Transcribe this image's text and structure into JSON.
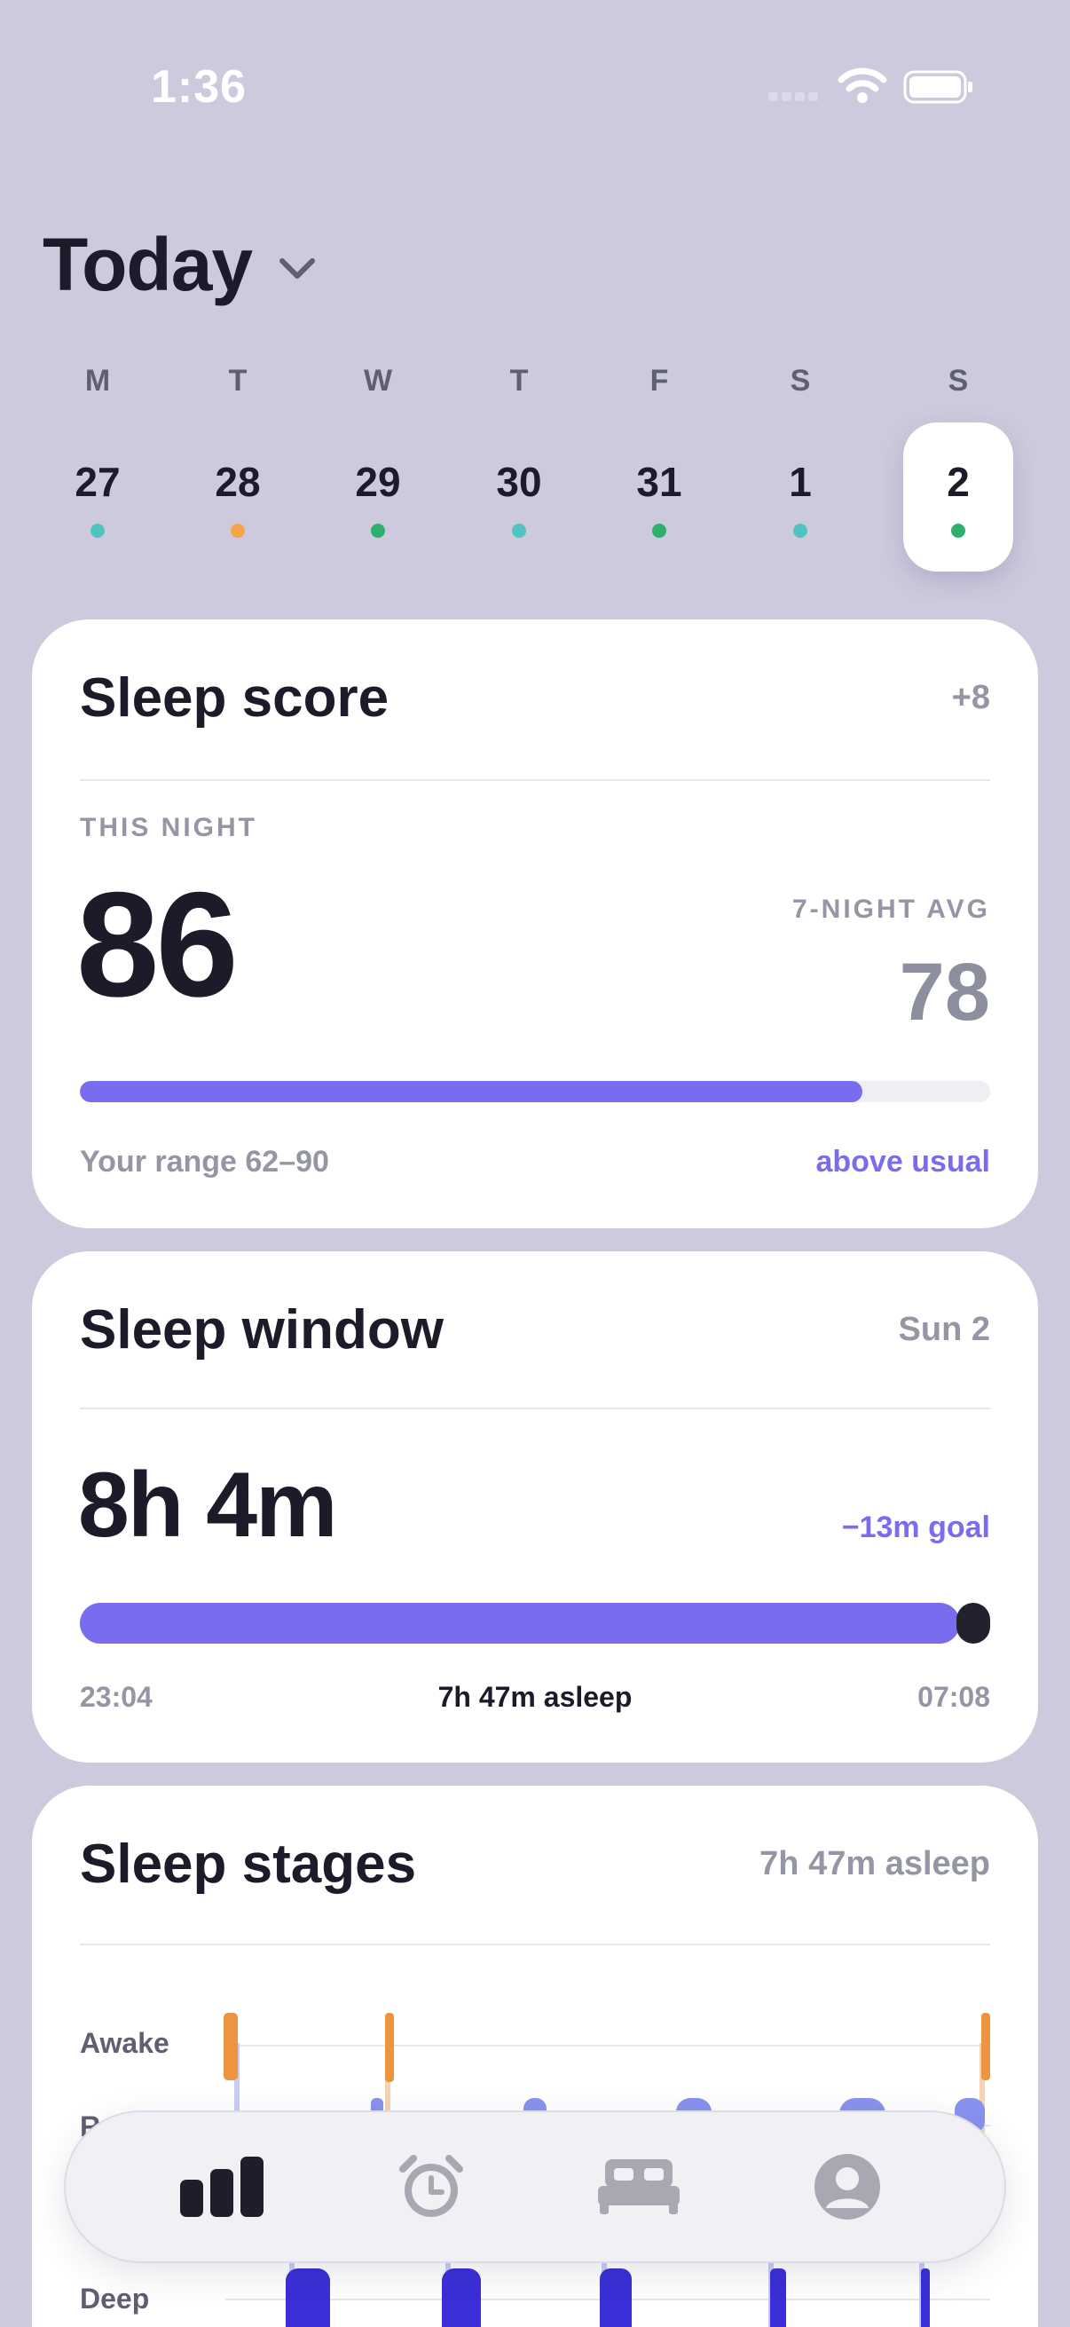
{
  "status_bar": {
    "time": "1:36"
  },
  "header": {
    "title": "Today"
  },
  "week": {
    "days": [
      {
        "letter": "M",
        "date": "27",
        "dot_color": "#4fc3c0",
        "selected": false
      },
      {
        "letter": "T",
        "date": "28",
        "dot_color": "#f5a44a",
        "selected": false
      },
      {
        "letter": "W",
        "date": "29",
        "dot_color": "#2db06b",
        "selected": false
      },
      {
        "letter": "T",
        "date": "30",
        "dot_color": "#4fc3c0",
        "selected": false
      },
      {
        "letter": "F",
        "date": "31",
        "dot_color": "#2db06b",
        "selected": false
      },
      {
        "letter": "S",
        "date": "1",
        "dot_color": "#4fc3c0",
        "selected": false
      },
      {
        "letter": "S",
        "date": "2",
        "dot_color": "#2db06b",
        "selected": true
      }
    ]
  },
  "score_card": {
    "title": "Sleep score",
    "delta": "+8",
    "this_night_label": "THIS NIGHT",
    "score": "86",
    "avg_label": "7-NIGHT AVG",
    "avg": "78",
    "progress_fraction": 0.86,
    "range_text": "Your range 62–90",
    "status_text": "above usual"
  },
  "window_card": {
    "title": "Sleep window",
    "date": "Sun 2",
    "duration": "8h 4m",
    "goal_delta": "−13m goal",
    "start": "23:04",
    "end": "07:08",
    "asleep": "7h 47m asleep"
  },
  "stages_card": {
    "title": "Sleep stages",
    "summary": "7h 47m asleep",
    "labels": [
      "Awake",
      "R",
      "Deep"
    ]
  },
  "nav": {
    "items": [
      "stats-icon",
      "alarm-icon",
      "bed-icon",
      "profile-icon"
    ]
  },
  "colors": {
    "accent": "#7a6cee",
    "awake": "#ec9440",
    "rem": "#8793ee",
    "deep": "#3a2fd8",
    "background": "#cdcadd"
  }
}
